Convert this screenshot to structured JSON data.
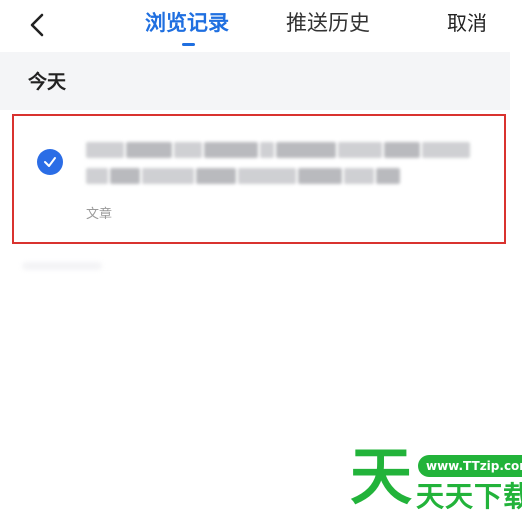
{
  "header": {
    "back_icon": "chevron-left-icon",
    "tabs": [
      {
        "label": "浏览记录",
        "active": true
      },
      {
        "label": "推送历史",
        "active": false
      }
    ],
    "cancel_label": "取消",
    "accent_color": "#1f6fe0"
  },
  "section": {
    "title": "今天"
  },
  "history_items": [
    {
      "selected": true,
      "check_icon": "checkmark-icon",
      "type_label": "文章",
      "highlight_color": "#d9322f"
    }
  ],
  "watermark": {
    "logo_char": "天",
    "url": "www.TTzip.com",
    "name": "天天下载",
    "color": "#22b33a"
  }
}
